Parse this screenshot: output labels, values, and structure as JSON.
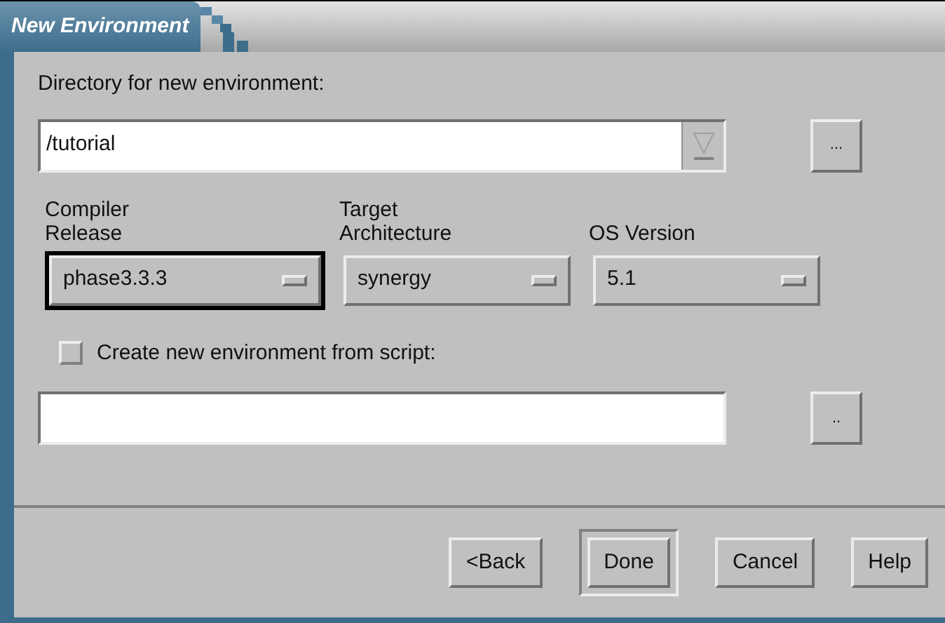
{
  "window": {
    "title": "New Environment"
  },
  "directory": {
    "label": "Directory for new environment:",
    "value": "/tutorial",
    "browse": "..."
  },
  "option_menus": [
    {
      "label": "Compiler\nRelease",
      "value": "phase3.3.3",
      "focused": true
    },
    {
      "label": "Target\nArchitecture",
      "value": "synergy",
      "focused": false
    },
    {
      "label": "OS Version",
      "value": "5.1",
      "focused": false
    }
  ],
  "script": {
    "label": "Create new environment from script:",
    "checked": false,
    "browse": ".."
  },
  "buttons": [
    {
      "label": "<Back",
      "default": false
    },
    {
      "label": "Done",
      "default": true
    },
    {
      "label": "Cancel",
      "default": false
    },
    {
      "label": "Help",
      "default": false
    }
  ]
}
